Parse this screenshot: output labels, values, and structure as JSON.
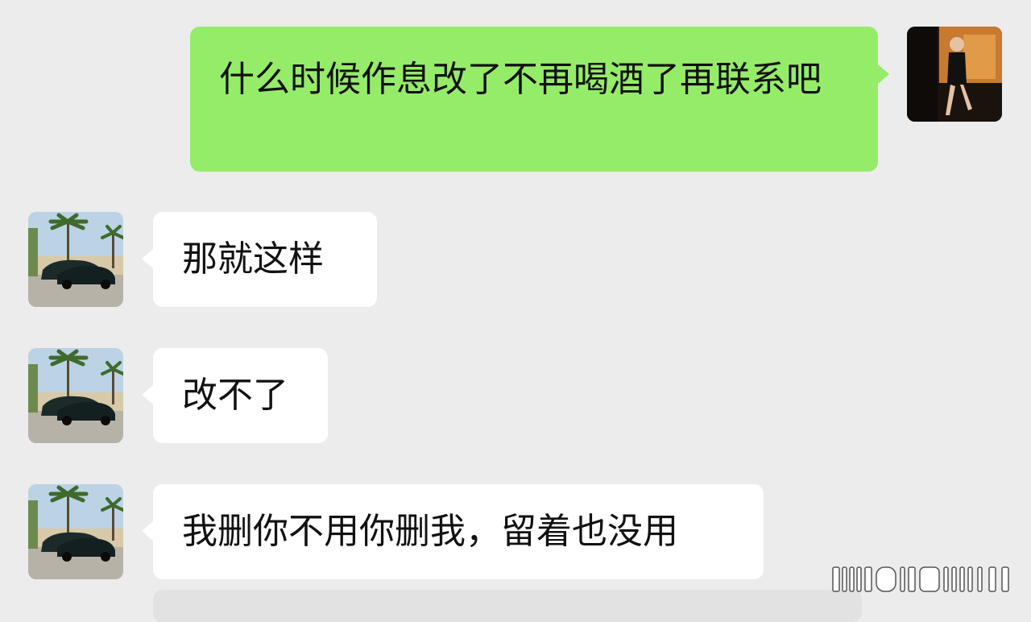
{
  "chat": {
    "messages": [
      {
        "side": "sent",
        "sender_avatar": "woman-in-car-avatar",
        "text": "什么时候作息改了不再喝酒了再联系吧"
      },
      {
        "side": "received",
        "sender_avatar": "palm-trees-cars-avatar",
        "text": "那就这样"
      },
      {
        "side": "received",
        "sender_avatar": "palm-trees-cars-avatar",
        "text": "改不了"
      },
      {
        "side": "received",
        "sender_avatar": "palm-trees-cars-avatar",
        "text": "我删你不用你删我，留着也没用"
      }
    ]
  },
  "colors": {
    "background": "#ececec",
    "sent_bubble": "#95ec69",
    "received_bubble": "#ffffff"
  }
}
